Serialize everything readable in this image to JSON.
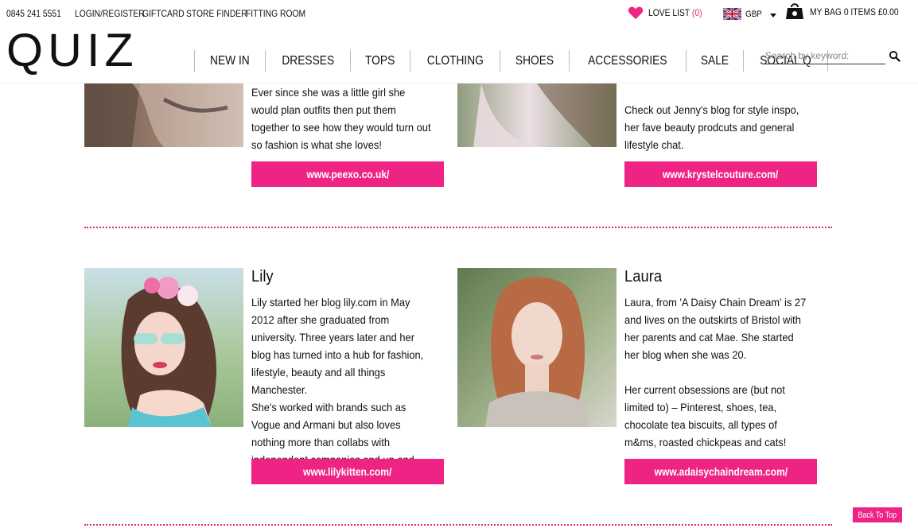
{
  "topbar": {
    "phone": "0845 241 5551",
    "login": "LOGIN/REGISTER",
    "giftcard": "GIFTCARD",
    "store_finder": "STORE FINDER",
    "fitting_room": "FITTING ROOM",
    "love_list_label": "LOVE LIST",
    "love_list_count": "(0)",
    "currency": "GBP",
    "bag_label": "MY BAG 0 ITEMS £0.00"
  },
  "brand": {
    "logo": "QUIZ",
    "accent_color": "#ee2384"
  },
  "nav": [
    "NEW IN",
    "DRESSES",
    "TOPS",
    "CLOTHING",
    "SHOES",
    "ACCESSORIES",
    "SALE",
    "SOCIAL Q"
  ],
  "search": {
    "placeholder": "Search by keyword:"
  },
  "bloggers_top": [
    {
      "text": [
        "Ever since she was a little girl she would plan outfits then put them together to see how they would turn out so fashion is what she loves!"
      ],
      "link": "www.peexo.co.uk/"
    },
    {
      "text": [
        "Check out Jenny's blog for style inspo, her fave beauty prodcuts and general lifestyle chat."
      ],
      "link": "www.krystelcouture.com/"
    }
  ],
  "bloggers": [
    {
      "name": "Lily",
      "text": [
        "Lily started her blog lily.com in May 2012 after she graduated from university. Three years later and her blog has turned into a hub for fashion, lifestyle, beauty and all things Manchester.",
        "She's worked with brands such as Vogue and Armani but also loves nothing more than collabs with independent companies and up and coming designers!"
      ],
      "link": "www.lilykitten.com/"
    },
    {
      "name": "Laura",
      "text": [
        "Laura, from 'A Daisy Chain Dream' is 27 and lives on the outskirts of Bristol with her parents and cat Mae. She started her blog when she was 20.",
        "Her current obsessions are (but not limited to) – Pinterest, shoes, tea, chocolate tea biscuits, all types of m&ms, roasted chickpeas and cats!"
      ],
      "link": "www.adaisychaindream.com/"
    }
  ],
  "back_to_top": "Back To Top"
}
